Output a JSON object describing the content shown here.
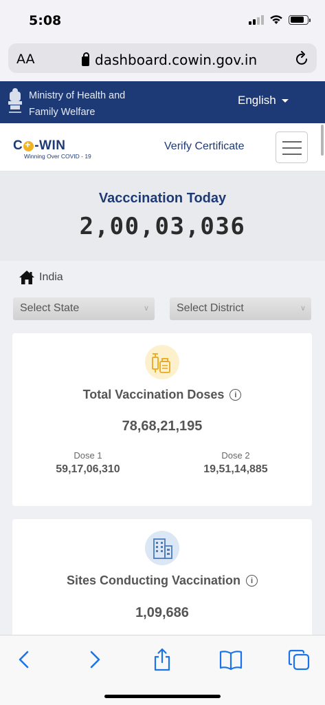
{
  "status": {
    "time": "5:08"
  },
  "browser": {
    "aa_label": "AA",
    "url": "dashboard.cowin.gov.in"
  },
  "header": {
    "ministry_line1": "Ministry of Health and",
    "ministry_line2": "Family Welfare",
    "language": "English"
  },
  "nav": {
    "logo_text_pre": "C",
    "logo_text_post": "-WIN",
    "logo_tagline": "Winning Over COVID - 19",
    "verify_label": "Verify Certificate"
  },
  "today": {
    "title": "Vacccination Today",
    "count": "2,00,03,036"
  },
  "location": {
    "breadcrumb": "India",
    "state_placeholder": "Select State",
    "district_placeholder": "Select District"
  },
  "total_doses": {
    "title": "Total Vaccination Doses",
    "total": "78,68,21,195",
    "dose1_label": "Dose 1",
    "dose1_value": "59,17,06,310",
    "dose2_label": "Dose 2",
    "dose2_value": "19,51,14,885"
  },
  "sites": {
    "title": "Sites Conducting Vaccination",
    "count": "1,09,686"
  },
  "colors": {
    "brand_navy": "#1e3a76",
    "accent_yellow": "#f0b321",
    "ios_blue": "#1a73e8"
  },
  "icons": [
    "lock-icon",
    "reload-icon",
    "emblem-icon",
    "home-icon",
    "vaccine-icon",
    "building-icon",
    "back-icon",
    "forward-icon",
    "share-icon",
    "bookmarks-icon",
    "tabs-icon"
  ]
}
